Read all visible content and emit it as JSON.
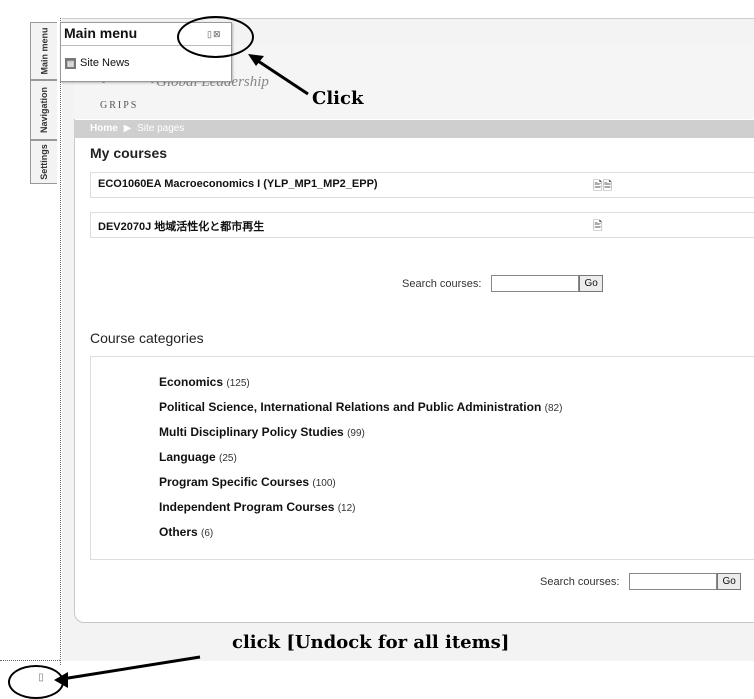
{
  "dock": {
    "tabs": [
      "Main menu",
      "Navigation",
      "Settings"
    ],
    "undock_icon": "undock-all-icon"
  },
  "menu_panel": {
    "title": "Main menu",
    "controls_icon": "dock-close-icon",
    "items": [
      {
        "label": "Site News",
        "icon": "news-icon"
      }
    ]
  },
  "header": {
    "logo_text": "GRIPS",
    "tagline": "Global Leadership"
  },
  "breadcrumb": {
    "home": "Home",
    "separator": "▶",
    "current": "Site pages"
  },
  "my_courses": {
    "heading": "My courses",
    "courses": [
      {
        "name": "ECO1060EA Macroeconomics I (YLP_MP1_MP2_EPP)",
        "icons": "🖹🗎"
      },
      {
        "name": "DEV2070J 地域活性化と都市再生",
        "icons": "🖹"
      }
    ]
  },
  "search_top": {
    "label": "Search courses:",
    "button": "Go"
  },
  "course_categories": {
    "heading": "Course categories",
    "items": [
      {
        "name": "Economics",
        "count": "(125)"
      },
      {
        "name": "Political Science, International Relations and Public Administration",
        "count": "(82)"
      },
      {
        "name": "Multi Disciplinary Policy Studies",
        "count": "(99)"
      },
      {
        "name": "Language",
        "count": "(25)"
      },
      {
        "name": "Program Specific Courses",
        "count": "(100)"
      },
      {
        "name": "Independent Program Courses",
        "count": "(12)"
      },
      {
        "name": "Others",
        "count": "(6)"
      }
    ]
  },
  "search_bottom": {
    "label": "Search courses:",
    "button": "Go"
  },
  "annotations": {
    "click_label": "Click",
    "undock_label": "click [Undock for all items]"
  }
}
